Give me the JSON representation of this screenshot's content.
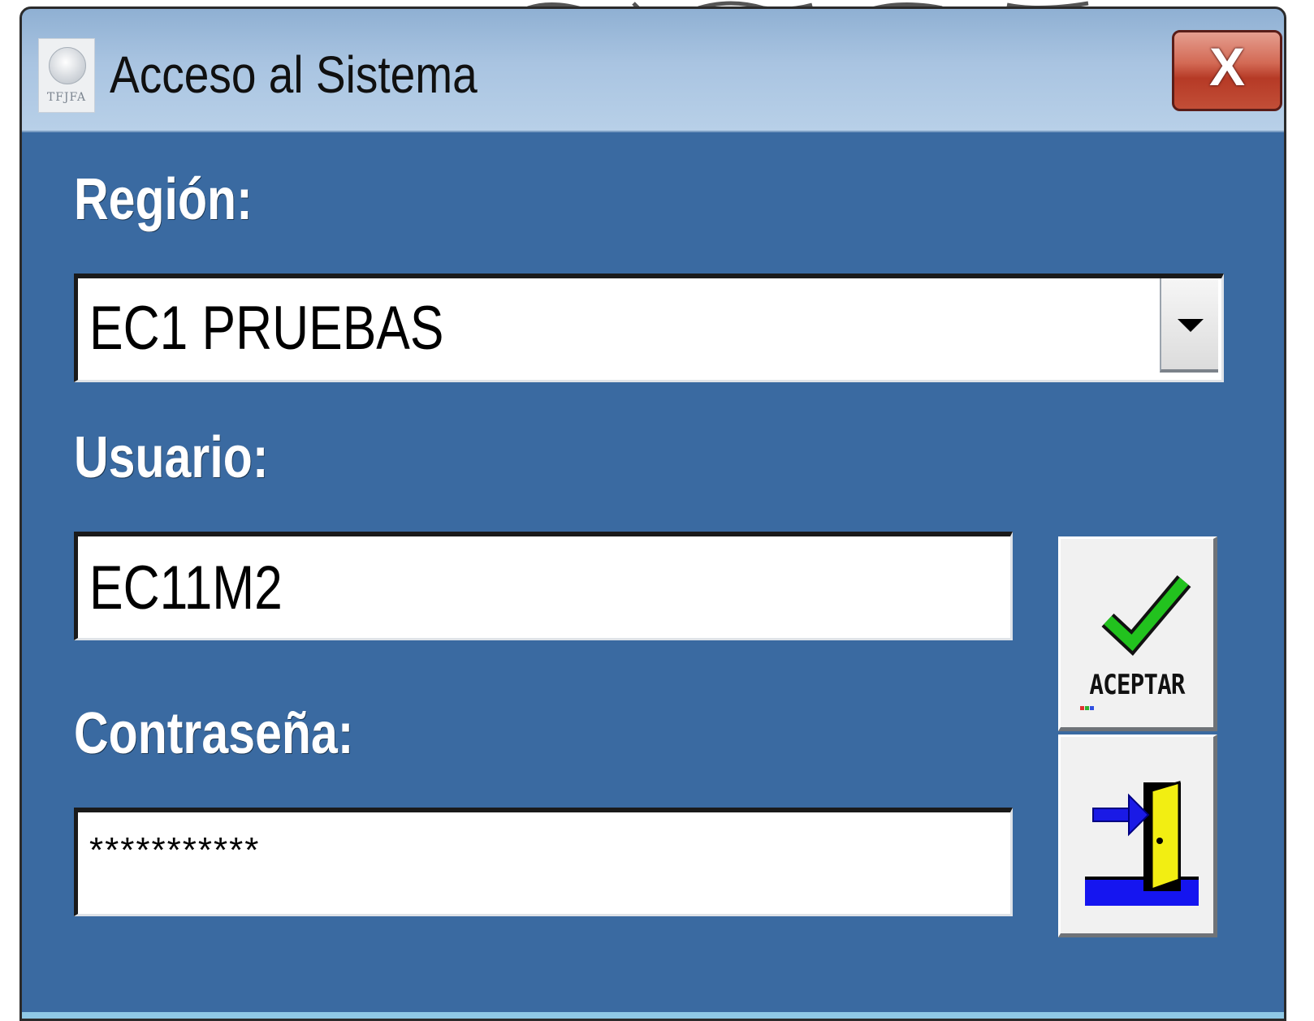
{
  "window": {
    "title": "Acceso al Sistema",
    "icon": "seal-icon",
    "icon_caption": "TFJFA",
    "close_label": "X"
  },
  "form": {
    "region_label": "Región:",
    "region_value": "EC1 PRUEBAS",
    "user_label": "Usuario:",
    "user_value": "EC11M2",
    "password_label": "Contraseña:",
    "password_value": "***********"
  },
  "buttons": {
    "accept_label": "ACEPTAR",
    "accept_icon": "checkmark-icon",
    "exit_icon": "exit-door-icon"
  },
  "colors": {
    "window_bg": "#3a6aa1",
    "titlebar": "#b8d0e8",
    "close_button": "#c24e37",
    "checkmark": "#22c21e",
    "door": "#f2ee12",
    "exit_arrow": "#1a1ae6"
  }
}
